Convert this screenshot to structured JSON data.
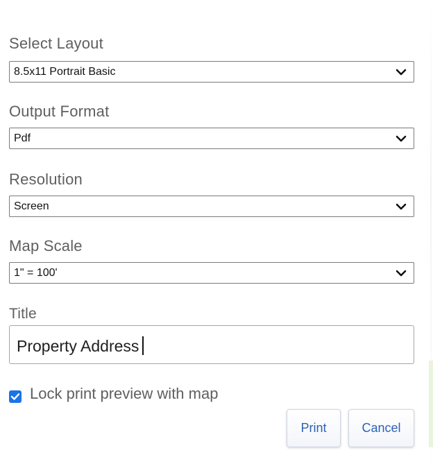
{
  "form": {
    "layout": {
      "label": "Select Layout",
      "value": "8.5x11 Portrait Basic"
    },
    "output_format": {
      "label": "Output Format",
      "value": "Pdf"
    },
    "resolution": {
      "label": "Resolution",
      "value": "Screen"
    },
    "map_scale": {
      "label": "Map Scale",
      "value": "1\" = 100'"
    },
    "title": {
      "label": "Title",
      "value": "Property Address"
    },
    "lock_preview": {
      "label": "Lock print preview with map",
      "checked": true
    }
  },
  "actions": {
    "print_label": "Print",
    "cancel_label": "Cancel"
  },
  "icons": {
    "dropdown": "chevron-down-icon",
    "check": "checkmark-icon"
  },
  "colors": {
    "label_text": "#5f5f5f",
    "button_text": "#2b62b5",
    "checkbox_fill": "#1a73e8"
  }
}
